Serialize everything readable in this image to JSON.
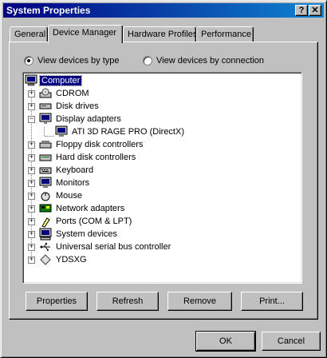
{
  "window": {
    "title": "System Properties"
  },
  "titlebar": {
    "help": "?",
    "close": "✕"
  },
  "tabs": [
    {
      "label": "General"
    },
    {
      "label": "Device Manager",
      "active": true
    },
    {
      "label": "Hardware Profiles"
    },
    {
      "label": "Performance"
    }
  ],
  "view_options": {
    "by_type": {
      "label": "View devices by type",
      "checked": true
    },
    "by_connection": {
      "label": "View devices by connection",
      "checked": false
    }
  },
  "tree": {
    "root": {
      "label": "Computer",
      "icon": "computer-icon",
      "selected": true
    },
    "items": [
      {
        "label": "CDROM",
        "icon": "cdrom-icon",
        "expander": "+"
      },
      {
        "label": "Disk drives",
        "icon": "disk-drive-icon",
        "expander": "+"
      },
      {
        "label": "Display adapters",
        "icon": "display-adapter-icon",
        "expander": "−"
      },
      {
        "label": "Floppy disk controllers",
        "icon": "floppy-controller-icon",
        "expander": "+"
      },
      {
        "label": "Hard disk controllers",
        "icon": "hard-disk-controller-icon",
        "expander": "+"
      },
      {
        "label": "Keyboard",
        "icon": "keyboard-icon",
        "expander": "+"
      },
      {
        "label": "Monitors",
        "icon": "monitor-icon",
        "expander": "+"
      },
      {
        "label": "Mouse",
        "icon": "mouse-icon",
        "expander": "+"
      },
      {
        "label": "Network adapters",
        "icon": "network-adapter-icon",
        "expander": "+"
      },
      {
        "label": "Ports (COM & LPT)",
        "icon": "ports-icon",
        "expander": "+"
      },
      {
        "label": "System devices",
        "icon": "system-devices-icon",
        "expander": "+"
      },
      {
        "label": "Universal serial bus controller",
        "icon": "usb-icon",
        "expander": "+"
      },
      {
        "label": "YDSXG",
        "icon": "ydsxg-icon",
        "expander": "+"
      }
    ],
    "child": {
      "label": "ATI 3D RAGE PRO (DirectX)",
      "icon": "monitor-icon",
      "parent": "Display adapters"
    }
  },
  "actions": {
    "properties": "Properties",
    "refresh": "Refresh",
    "remove": "Remove",
    "print": "Print..."
  },
  "footer": {
    "ok": "OK",
    "cancel": "Cancel"
  }
}
